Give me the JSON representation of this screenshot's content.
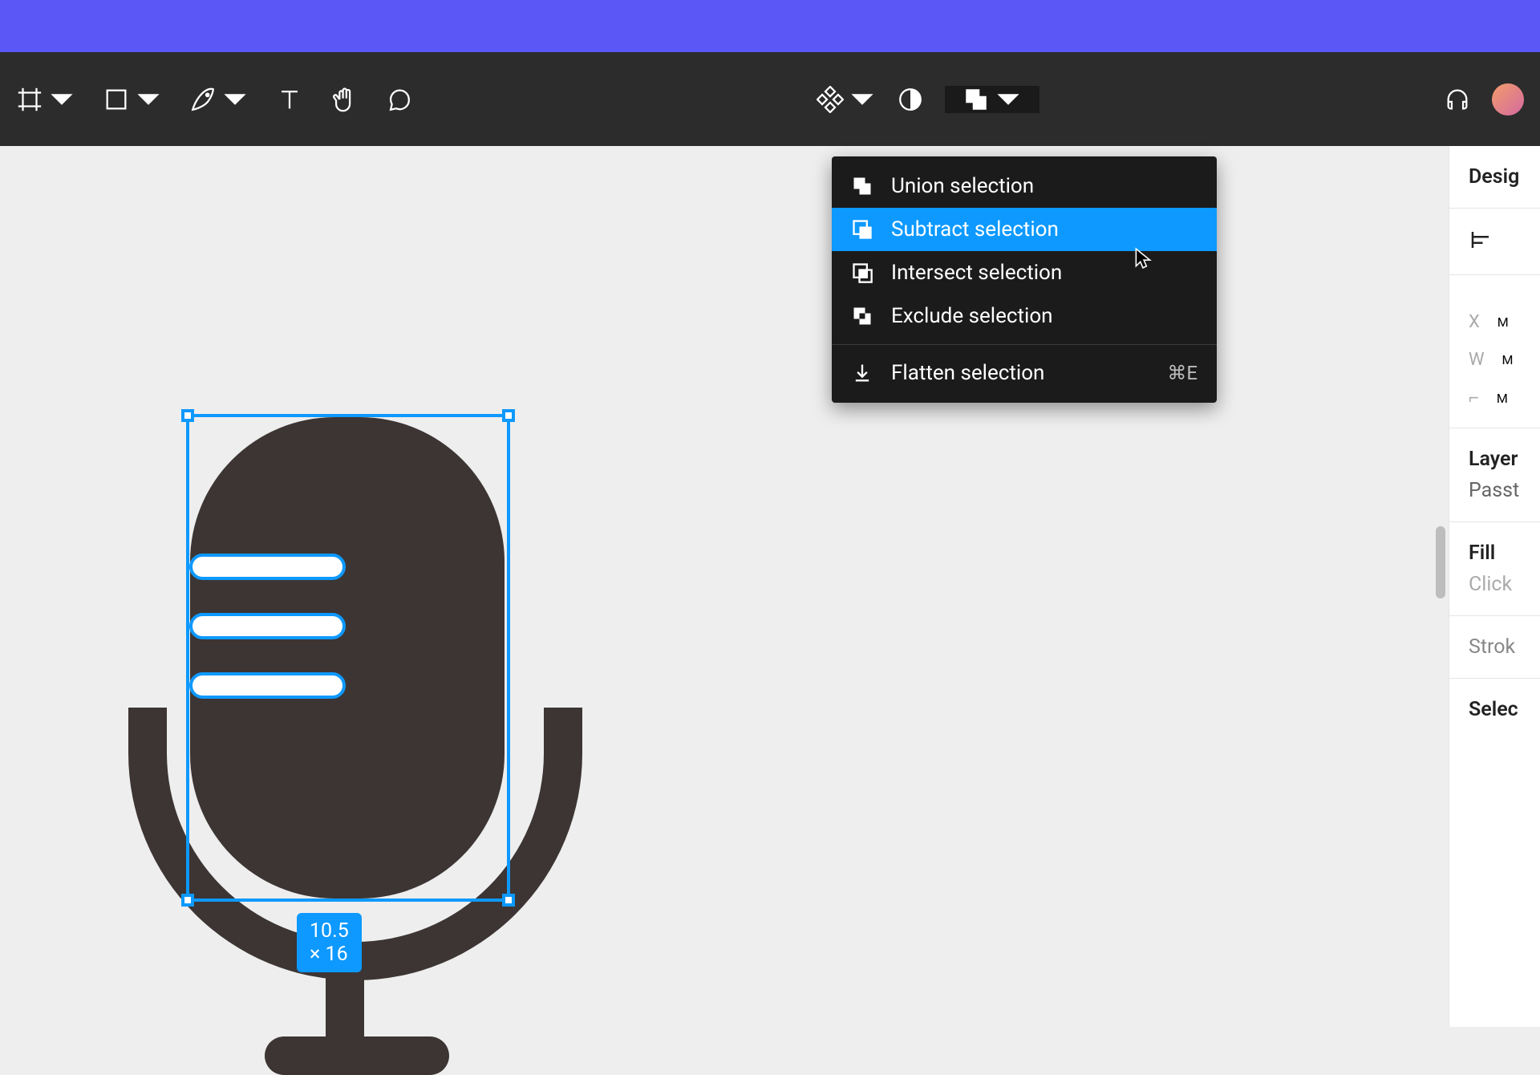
{
  "banner": {},
  "toolbar": {
    "tools_left": [
      {
        "name": "frame-tool",
        "has_chevron": true
      },
      {
        "name": "shape-tool",
        "has_chevron": true
      },
      {
        "name": "pen-tool",
        "has_chevron": true
      },
      {
        "name": "text-tool",
        "has_chevron": false
      },
      {
        "name": "hand-tool",
        "has_chevron": false
      },
      {
        "name": "comment-tool",
        "has_chevron": false
      }
    ],
    "tools_center": [
      {
        "name": "components-tool",
        "has_chevron": true
      },
      {
        "name": "mask-tool",
        "has_chevron": false
      },
      {
        "name": "boolean-tool",
        "has_chevron": true,
        "active": true
      }
    ],
    "tools_right": [
      {
        "name": "headphones-icon"
      },
      {
        "name": "avatar"
      }
    ]
  },
  "dropdown": {
    "items": [
      {
        "icon": "union-icon",
        "label": "Union selection"
      },
      {
        "icon": "subtract-icon",
        "label": "Subtract selection",
        "highlight": true
      },
      {
        "icon": "intersect-icon",
        "label": "Intersect selection"
      },
      {
        "icon": "exclude-icon",
        "label": "Exclude selection"
      }
    ],
    "flatten": {
      "icon": "flatten-icon",
      "label": "Flatten selection",
      "shortcut": "⌘E"
    }
  },
  "canvas": {
    "selection_dimensions": "10.5 × 16"
  },
  "right_panel": {
    "tab_design": "Desig",
    "prop_x": "X",
    "prop_x_val": "M",
    "prop_w": "W",
    "prop_w_val": "M",
    "prop_angle": "⌐",
    "prop_angle_val": "M",
    "layer_title": "Layer",
    "layer_mode": "Passt",
    "fill_title": "Fill",
    "fill_hint": "Click",
    "stroke_title": "Strok",
    "select_title": "Selec"
  }
}
